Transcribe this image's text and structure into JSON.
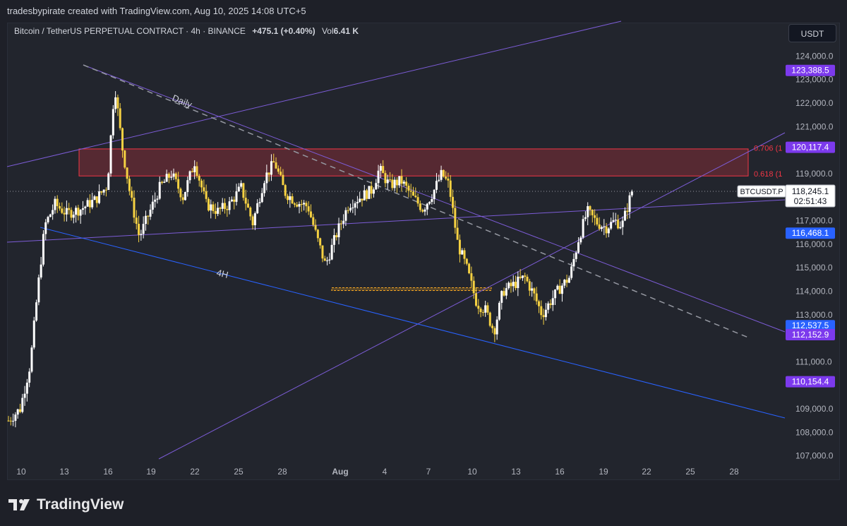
{
  "header": {
    "caption": "tradesbypirate created with TradingView.com, Aug 10, 2025 14:08 UTC+5",
    "symbol_line": "Bitcoin / TetherUS PERPETUAL CONTRACT · 4h · BINANCE",
    "change": "+475.1 (+0.40%)",
    "volume_label": "Vol",
    "volume_value": "6.41 K",
    "currency_button": "USDT"
  },
  "footer": {
    "brand": "TradingView"
  },
  "colors": {
    "candle_up": "#ffffff",
    "candle_down": "#f5d142",
    "trendline_purple": "#7c5cd6",
    "trendline_blue": "#2962ff",
    "resistance_zone": "#f23645",
    "support_zone": "#f5a623",
    "current_price_label": "#ffffff",
    "fib_text": "#f23645"
  },
  "chart_data": {
    "type": "candlestick",
    "interval": "4h",
    "ylim": [
      106500,
      124800
    ],
    "x_ticks": [
      "10",
      "13",
      "16",
      "19",
      "22",
      "25",
      "28",
      "Aug",
      "4",
      "7",
      "10",
      "13",
      "16",
      "19",
      "22",
      "25",
      "28"
    ],
    "y_ticks": [
      "124,000.0",
      "123,000.0",
      "122,000.0",
      "121,000.0",
      "119,000.0",
      "117,000.0",
      "116,000.0",
      "115,000.0",
      "114,000.0",
      "113,000.0",
      "111,000.0",
      "109,000.0",
      "108,000.0",
      "107,000.0"
    ],
    "price_path": [
      [
        0,
        108500
      ],
      [
        0.8,
        109000
      ],
      [
        1.5,
        110900
      ],
      [
        2.0,
        114000
      ],
      [
        2.5,
        116800
      ],
      [
        3.2,
        117700
      ],
      [
        4.0,
        117300
      ],
      [
        5.0,
        117500
      ],
      [
        6.0,
        117900
      ],
      [
        6.8,
        118500
      ],
      [
        7.3,
        122800
      ],
      [
        7.8,
        120200
      ],
      [
        8.4,
        118000
      ],
      [
        9.0,
        116300
      ],
      [
        9.6,
        117200
      ],
      [
        10.4,
        118400
      ],
      [
        11.2,
        119000
      ],
      [
        12.0,
        118000
      ],
      [
        12.8,
        119500
      ],
      [
        13.6,
        117700
      ],
      [
        14.4,
        117400
      ],
      [
        15.2,
        117700
      ],
      [
        16.0,
        118400
      ],
      [
        16.8,
        116900
      ],
      [
        17.6,
        118800
      ],
      [
        18.3,
        119500
      ],
      [
        19.0,
        118200
      ],
      [
        19.8,
        117800
      ],
      [
        20.6,
        117600
      ],
      [
        21.2,
        116300
      ],
      [
        21.8,
        115100
      ],
      [
        22.6,
        116500
      ],
      [
        23.4,
        117700
      ],
      [
        24.2,
        118000
      ],
      [
        25.0,
        118300
      ],
      [
        25.5,
        119200
      ],
      [
        26.2,
        118500
      ],
      [
        27.0,
        118700
      ],
      [
        27.8,
        118000
      ],
      [
        28.5,
        117500
      ],
      [
        29.2,
        118200
      ],
      [
        29.8,
        119000
      ],
      [
        30.3,
        118500
      ],
      [
        30.9,
        116000
      ],
      [
        31.5,
        115000
      ],
      [
        32.2,
        113500
      ],
      [
        32.8,
        113200
      ],
      [
        33.4,
        112300
      ],
      [
        34.0,
        114000
      ],
      [
        34.8,
        114300
      ],
      [
        35.5,
        114600
      ],
      [
        36.1,
        113900
      ],
      [
        36.7,
        113000
      ],
      [
        37.3,
        113600
      ],
      [
        38.0,
        114200
      ],
      [
        38.6,
        114600
      ],
      [
        39.2,
        116200
      ],
      [
        39.8,
        117400
      ],
      [
        40.5,
        116900
      ],
      [
        41.1,
        116700
      ],
      [
        41.7,
        117000
      ],
      [
        42.2,
        116800
      ],
      [
        42.9,
        118300
      ]
    ],
    "price_labels": [
      {
        "text": "123,388.5",
        "price": 123388.5,
        "color": "#7c3aed"
      },
      {
        "text": "120,117.4",
        "price": 120117.4,
        "color": "#7c3aed"
      },
      {
        "text": "116,468.1",
        "price": 116468.1,
        "color": "#2962ff"
      },
      {
        "text": "112,537.5",
        "price": 112537.5,
        "color": "#2962ff"
      },
      {
        "text": "112,152.9",
        "price": 112152.9,
        "color": "#7c3aed"
      },
      {
        "text": "110,154.4",
        "price": 110154.4,
        "color": "#7c3aed"
      }
    ],
    "current_price": {
      "symbol": "BTCUSDT.P",
      "price": "118,245.1",
      "countdown": "02:51:43",
      "value": 118245.1
    },
    "fib_levels": [
      {
        "label": "0.706 (1",
        "price": 120100
      },
      {
        "label": "0.618 (1",
        "price": 119000
      }
    ],
    "annotations": [
      {
        "text": "Daily",
        "kind": "trendline-label"
      },
      {
        "text": "4H",
        "kind": "trendline-label"
      }
    ],
    "zones": [
      {
        "kind": "resistance",
        "top": 120050,
        "bottom": 118900
      },
      {
        "kind": "support",
        "top": 114150,
        "bottom": 114050
      }
    ],
    "grid": false
  }
}
